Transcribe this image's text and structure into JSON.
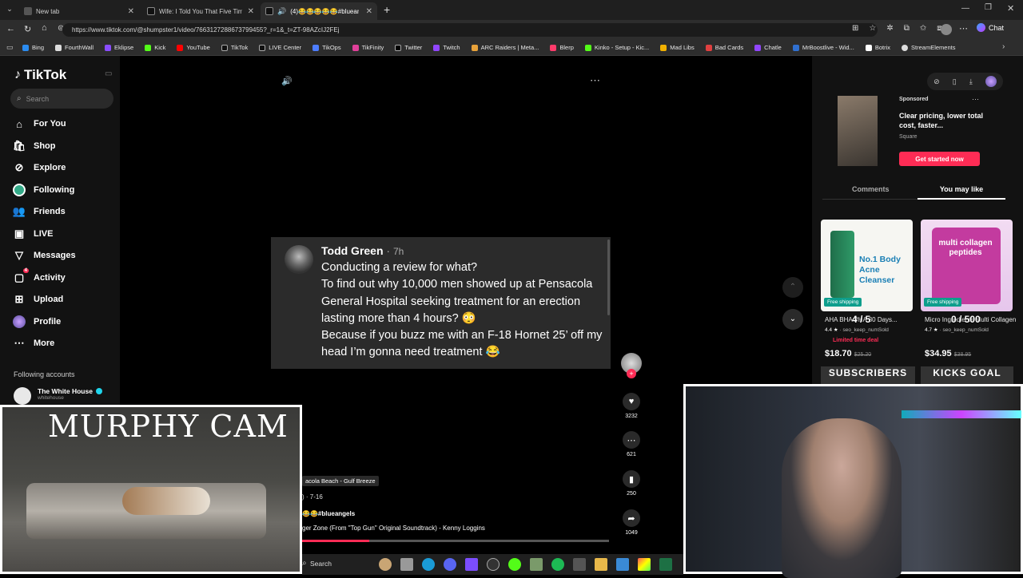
{
  "browser": {
    "tabs": [
      {
        "title": "New tab"
      },
      {
        "title": "Wife: I Told You That Five Times A..."
      },
      {
        "title": "(4)😂😂😂😂😂#blueangels"
      }
    ],
    "url": "https://www.tiktok.com/@shumpster1/video/7663127288673799455?_r=1&_t=ZT-98AZcIJ2FEj",
    "chat_label": "Chat",
    "bookmarks": [
      "Bing",
      "FourthWall",
      "Eklipse",
      "Kick",
      "YouTube",
      "TikTok",
      "LIVE Center",
      "TikOps",
      "TikFinity",
      "Twitter",
      "Twitch",
      "ARC Raiders | Meta...",
      "Blerp",
      "Kinko - Setup - Kic...",
      "Mad Libs",
      "Bad Cards",
      "Chatle",
      "MrBoostlive - Wid...",
      "Botrix",
      "StreamElements"
    ]
  },
  "tiktok": {
    "logo": "TikTok",
    "search_placeholder": "Search",
    "nav": [
      {
        "label": "For You",
        "icon": "home-icon"
      },
      {
        "label": "Shop",
        "icon": "shop-icon"
      },
      {
        "label": "Explore",
        "icon": "compass-icon"
      },
      {
        "label": "Following",
        "icon": "following-avatar-icon"
      },
      {
        "label": "Friends",
        "icon": "friends-icon"
      },
      {
        "label": "LIVE",
        "icon": "live-icon"
      },
      {
        "label": "Messages",
        "icon": "messages-icon"
      },
      {
        "label": "Activity",
        "icon": "activity-icon",
        "badge": "4"
      },
      {
        "label": "Upload",
        "icon": "upload-icon"
      },
      {
        "label": "Profile",
        "icon": "profile-icon"
      },
      {
        "label": "More",
        "icon": "more-dots-icon"
      }
    ],
    "following_header": "Following accounts",
    "following_account": {
      "name": "The White House",
      "handle": "whitehouse"
    }
  },
  "video": {
    "comment": {
      "author": "Todd Green",
      "time": "7h",
      "text": "Conducting a review for what?\nTo find out why 10,000 men showed up at Pensacola General Hospital seeking treatment for an erection lasting more than 4 hours? 😳\nBecause if you buzz me with an F-18 Hornet 25’ off my head I’m gonna need treatment 😂"
    },
    "location": "acola Beach - Gulf Breeze",
    "date": ") · 7-16",
    "hashtag": "😂😂#blueangels",
    "music": "ger Zone (From \"Top Gun\" Original Soundtrack) - Kenny Loggins",
    "actions": {
      "likes": "3232",
      "comments": "621",
      "saves": "250",
      "shares": "1049"
    }
  },
  "right_panel": {
    "sponsored_label": "Sponsored",
    "ad_title": "Clear pricing, lower total cost, faster...",
    "ad_brand": "Square",
    "ad_cta": "Get started now",
    "tabs": [
      "Comments",
      "You may like"
    ],
    "products": [
      {
        "title": "AHA BHA PHA 30 Days...",
        "rating": "4.4 ★",
        "sold": "seo_keep_numSold",
        "deal": "Limited time deal",
        "price": "$18.70",
        "old_price": "$25.20",
        "badge": "Free shipping",
        "box_text": "No.1 Body Acne Cleanser"
      },
      {
        "title": "Micro Ingredients Multi Collagen Peptides Powder...",
        "rating": "4.7 ★",
        "sold": "seo_keep_numSold",
        "price": "$34.95",
        "old_price": "$38.95",
        "badge": "Free shipping",
        "box_text": "multi collagen peptides"
      }
    ]
  },
  "overlays": {
    "murphy_label": "MURPHY CAM",
    "subscribers_label": "SUBSCRIBERS",
    "kicks_goal_label": "KICKS GOAL",
    "sub_count": "4 / 5",
    "kicks_count": "0 / 500"
  },
  "taskbar": {
    "search": "Search"
  }
}
